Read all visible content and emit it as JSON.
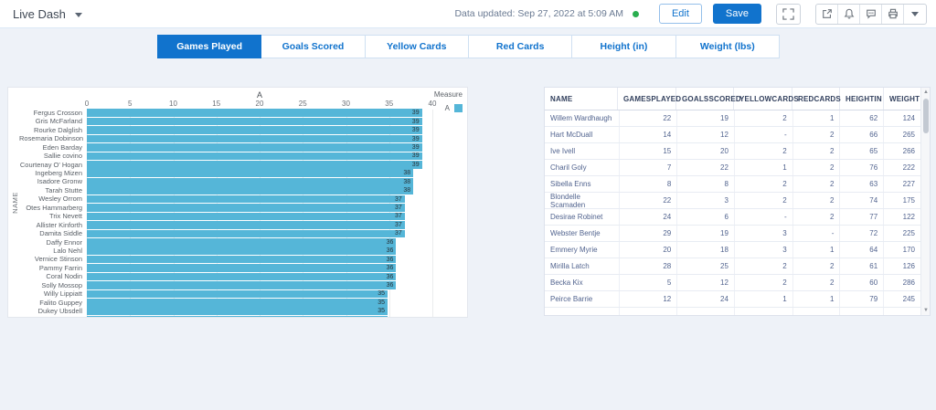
{
  "header": {
    "title": "Live Dash",
    "data_updated": "Data updated: Sep 27, 2022 at 5:09 AM",
    "edit_label": "Edit",
    "save_label": "Save",
    "icons": [
      "caret-down",
      "expand",
      "export",
      "bell",
      "comment",
      "print",
      "caret-down"
    ]
  },
  "colors": {
    "accent_blue": "#1173cd",
    "bar_blue": "#55b6d8",
    "status_green": "#2aae4f",
    "page_background": "#eef2f8"
  },
  "tabs": [
    {
      "label": "Games Played",
      "active": true
    },
    {
      "label": "Goals Scored",
      "active": false
    },
    {
      "label": "Yellow Cards",
      "active": false
    },
    {
      "label": "Red Cards",
      "active": false
    },
    {
      "label": "Height (in)",
      "active": false
    },
    {
      "label": "Weight (lbs)",
      "active": false
    }
  ],
  "chart_data": {
    "type": "bar",
    "orientation": "horizontal",
    "title": "A",
    "ylabel": "NAME",
    "xlim": [
      0,
      40
    ],
    "xticks": [
      0,
      5,
      10,
      15,
      20,
      25,
      30,
      35,
      40
    ],
    "grid": true,
    "legend": {
      "position": "right",
      "title": "Measure",
      "series_label": "A",
      "color": "#55b6d8"
    },
    "categories": [
      "Fergus Crosson",
      "Gris McFarland",
      "Rourke Dalglish",
      "Rosemaria Dobinson",
      "Eden Barday",
      "Sallie covino",
      "Courtenay O' Hogan",
      "Ingeberg Mizen",
      "Isadore Gronw",
      "Tarah Stutte",
      "Wesley Orrom",
      "Otes Hammarberg",
      "Trix Nevett",
      "Allister Kinforth",
      "Damita Siddle",
      "Daffy Ennor",
      "Lalo Nehl",
      "Vernice Stinson",
      "Pammy Farrin",
      "Coral Nodin",
      "Solly Mossop",
      "Willy Lippiatt",
      "Falito Guppey",
      "Dukey Ubsdell",
      ""
    ],
    "values": [
      39,
      39,
      39,
      39,
      39,
      39,
      39,
      38,
      38,
      38,
      37,
      37,
      37,
      37,
      37,
      36,
      36,
      36,
      36,
      36,
      36,
      35,
      35,
      35,
      35
    ],
    "last_row_clipped": true
  },
  "table": {
    "columns": [
      "NAME",
      "GAMESPLAYED",
      "GOALSSCORED",
      "YELLOWCARDS",
      "REDCARDS",
      "HEIGHTIN",
      "WEIGHT"
    ],
    "rows": [
      [
        "Willem Wardhaugh",
        22,
        19,
        2,
        1,
        62,
        124
      ],
      [
        "Hart McDuall",
        14,
        12,
        "-",
        2,
        66,
        265
      ],
      [
        "Ive Ivell",
        15,
        20,
        2,
        2,
        65,
        266
      ],
      [
        "Charil Goly",
        7,
        22,
        1,
        2,
        76,
        222
      ],
      [
        "Sibella Enns",
        8,
        8,
        2,
        2,
        63,
        227
      ],
      [
        "Blondelle Scamaden",
        22,
        3,
        2,
        2,
        74,
        175
      ],
      [
        "Desirae Robinet",
        24,
        6,
        "-",
        2,
        77,
        122
      ],
      [
        "Webster Bentje",
        29,
        19,
        3,
        "-",
        72,
        225
      ],
      [
        "Emmery Myrie",
        20,
        18,
        3,
        1,
        64,
        170
      ],
      [
        "Mirilla Latch",
        28,
        25,
        2,
        2,
        61,
        126
      ],
      [
        "Becka Kix",
        5,
        12,
        2,
        2,
        60,
        286
      ],
      [
        "Peirce Barrie",
        12,
        24,
        1,
        1,
        79,
        245
      ]
    ]
  }
}
